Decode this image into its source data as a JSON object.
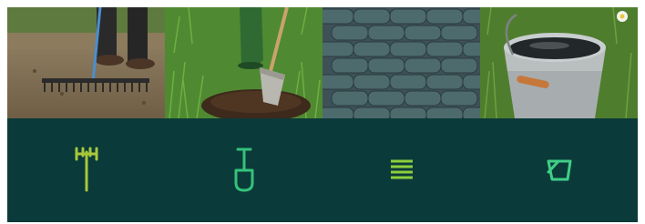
{
  "panels": [
    {
      "photo": "raking-soil-photo",
      "icon": "rake-icon",
      "icon_color": "#a8c83a"
    },
    {
      "photo": "digging-spade-photo",
      "icon": "shovel-icon",
      "icon_color": "#34c27a"
    },
    {
      "photo": "compost-bags-photo",
      "icon": "stacked-bags-icon",
      "icon_color": "#8ccf3a"
    },
    {
      "photo": "water-bucket-photo",
      "icon": "bucket-icon",
      "icon_color": "#3fcf86"
    }
  ],
  "colors": {
    "tile_background": "#0b3a3a"
  }
}
